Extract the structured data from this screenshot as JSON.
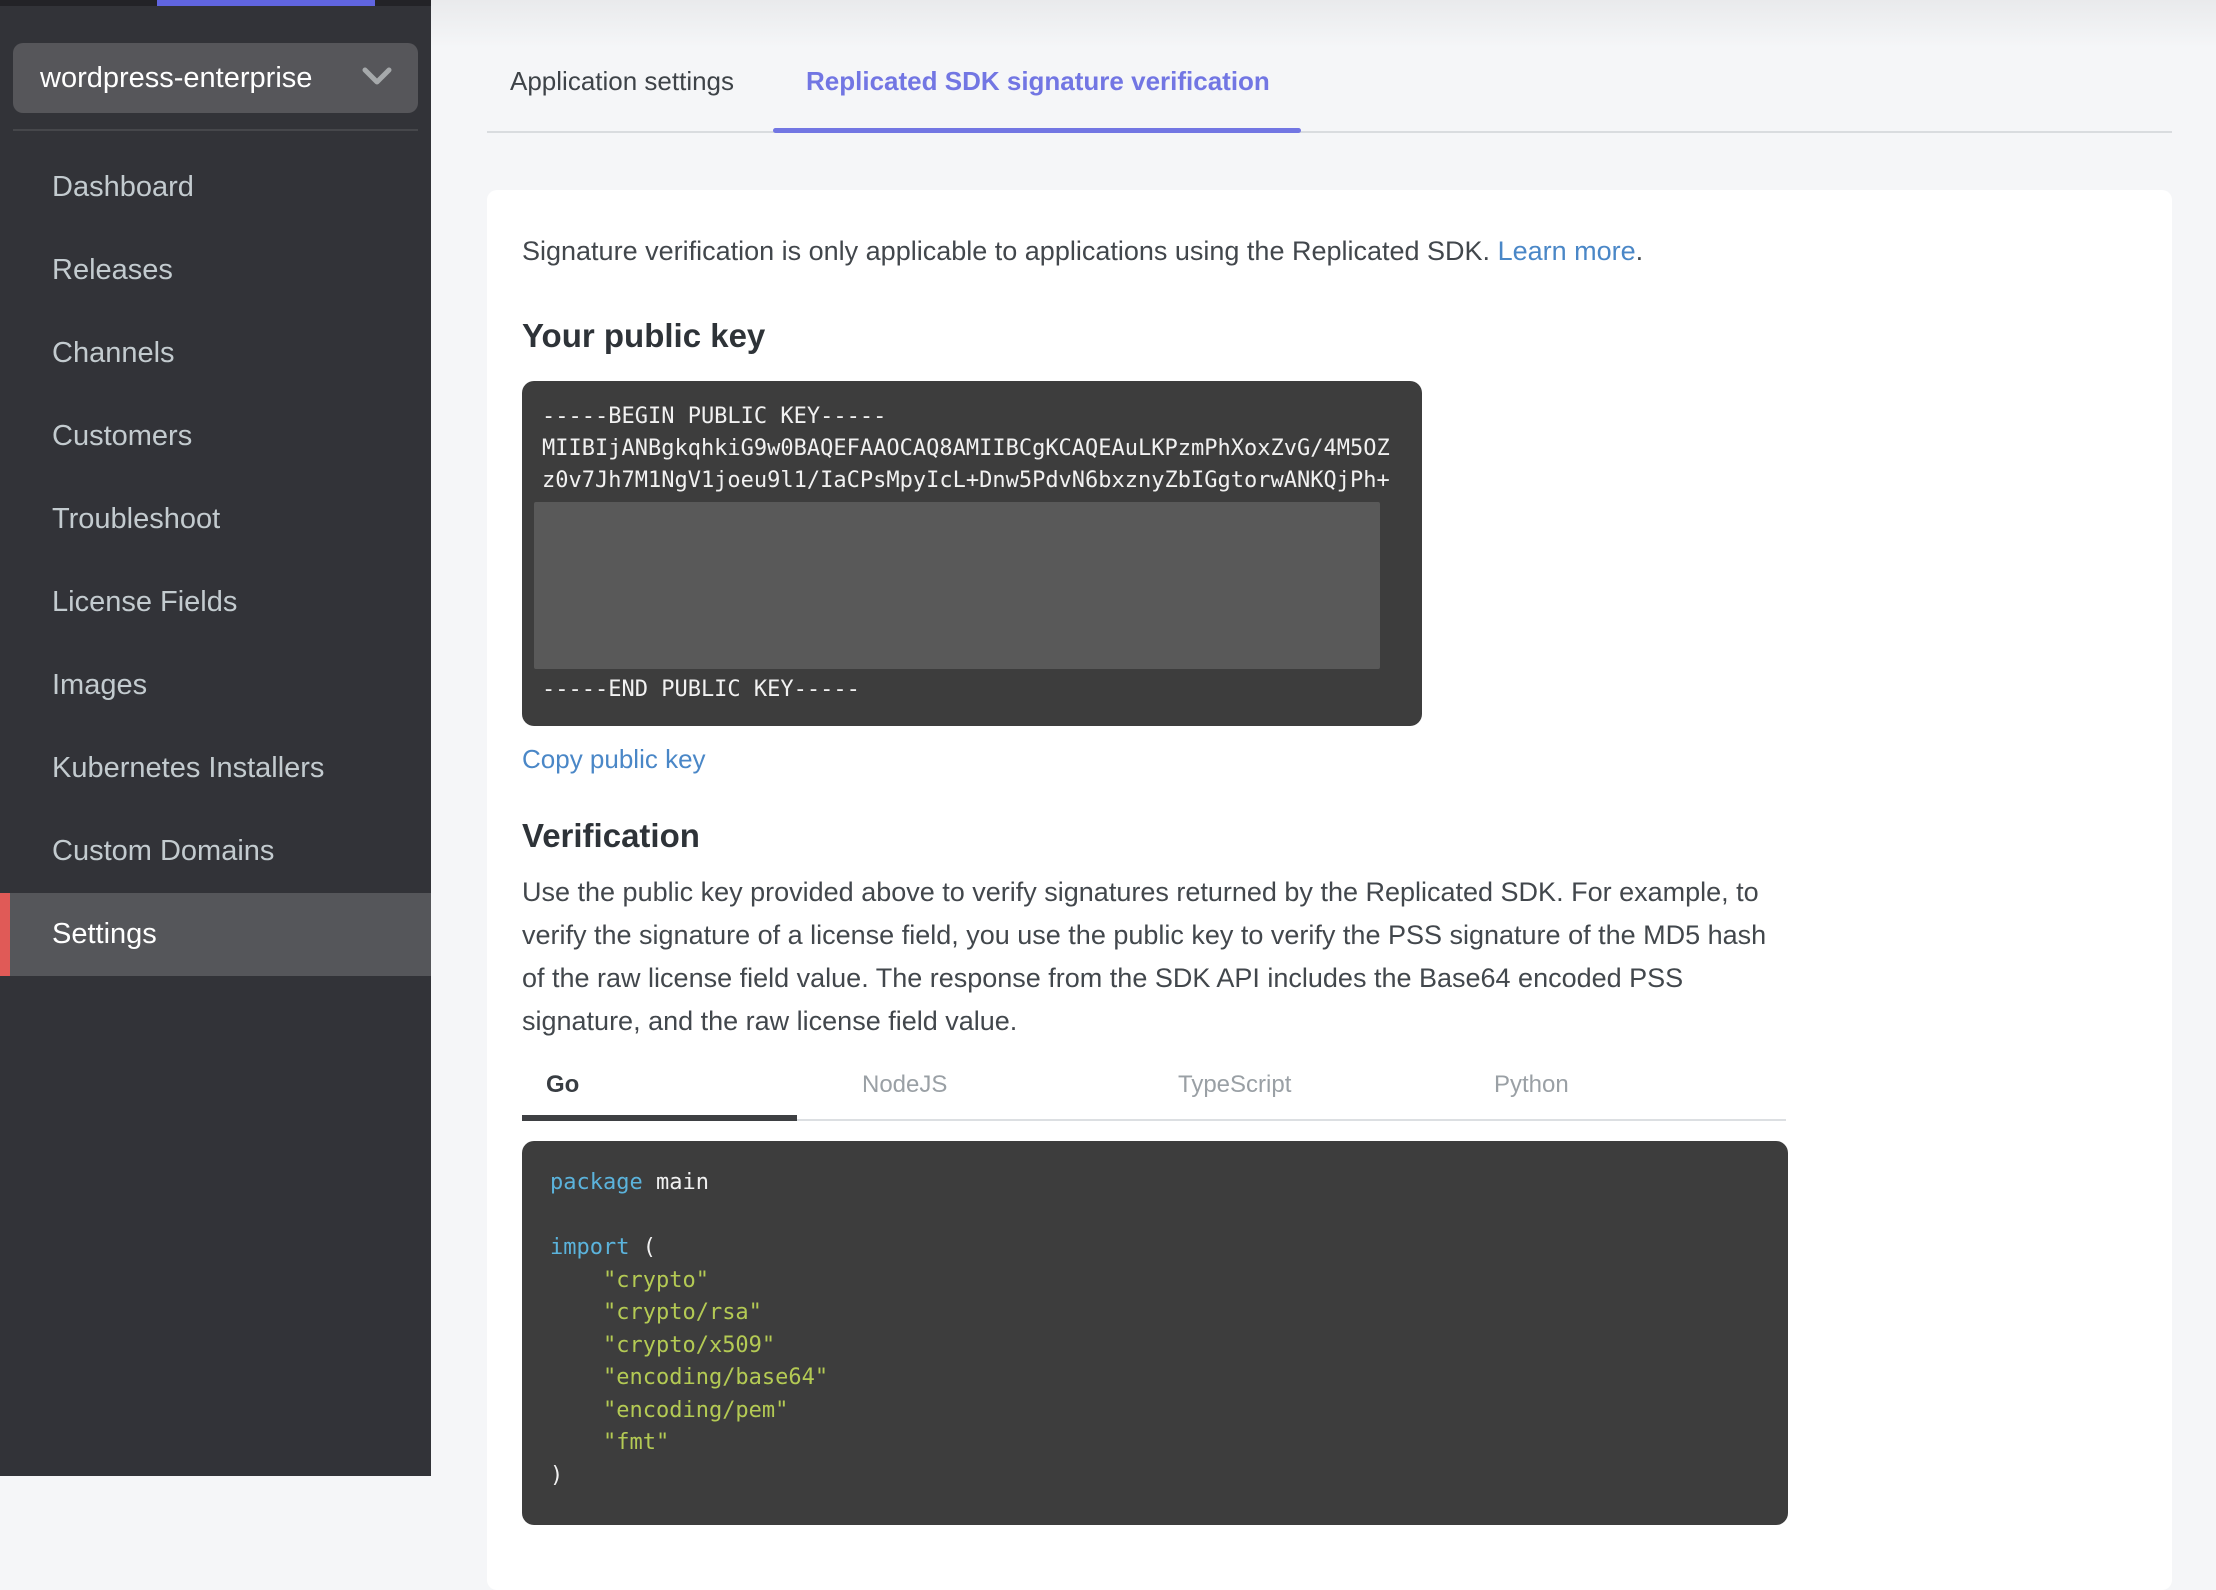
{
  "top_bar": {
    "accent_color": "#6065e0"
  },
  "sidebar": {
    "app_selector": {
      "value": "wordpress-enterprise"
    },
    "items": [
      {
        "label": "Dashboard",
        "selected": false
      },
      {
        "label": "Releases",
        "selected": false
      },
      {
        "label": "Channels",
        "selected": false
      },
      {
        "label": "Customers",
        "selected": false
      },
      {
        "label": "Troubleshoot",
        "selected": false
      },
      {
        "label": "License Fields",
        "selected": false
      },
      {
        "label": "Images",
        "selected": false
      },
      {
        "label": "Kubernetes Installers",
        "selected": false
      },
      {
        "label": "Custom Domains",
        "selected": false
      },
      {
        "label": "Settings",
        "selected": true
      }
    ],
    "selected_accent_color": "#e05a57"
  },
  "tabs": [
    {
      "label": "Application settings",
      "active": false
    },
    {
      "label": "Replicated SDK signature verification",
      "active": true
    }
  ],
  "content": {
    "intro": {
      "text": "Signature verification is only applicable to applications using the Replicated SDK. ",
      "link": "Learn more",
      "after_link": "."
    },
    "public_key": {
      "heading": "Your public key",
      "lines_visible_top": [
        "-----BEGIN PUBLIC KEY-----",
        "MIIBIjANBgkqhkiG9w0BAQEFAAOCAQ8AMIIBCgKCAQEAuLKPzmPhXoxZvG/4M5OZ",
        "z0v7Jh7M1NgV1joeu9l1/IaCPsMpyIcL+Dnw5PdvN6bxznyZbIGgtorwANKQjPh+"
      ],
      "redacted_region": true,
      "line_end": "-----END PUBLIC KEY-----",
      "copy_link": "Copy public key"
    },
    "verification": {
      "heading": "Verification",
      "body": "Use the public key provided above to verify signatures returned by the Replicated SDK. For example, to verify the signature of a license field, you use the public key to verify the PSS signature of the MD5 hash of the raw license field value. The response from the SDK API includes the Base64 encoded PSS signature, and the raw license field value.",
      "lang_tabs": [
        {
          "label": "Go",
          "active": true
        },
        {
          "label": "NodeJS",
          "active": false
        },
        {
          "label": "TypeScript",
          "active": false
        },
        {
          "label": "Python",
          "active": false
        }
      ],
      "code": {
        "language": "go",
        "lines": [
          [
            {
              "t": "kw",
              "v": "package"
            },
            {
              "t": "plain",
              "v": " main"
            }
          ],
          [],
          [
            {
              "t": "kw",
              "v": "import"
            },
            {
              "t": "plain",
              "v": " ("
            }
          ],
          [
            {
              "t": "plain",
              "v": "    "
            },
            {
              "t": "str",
              "v": "\"crypto\""
            }
          ],
          [
            {
              "t": "plain",
              "v": "    "
            },
            {
              "t": "str",
              "v": "\"crypto/rsa\""
            }
          ],
          [
            {
              "t": "plain",
              "v": "    "
            },
            {
              "t": "str",
              "v": "\"crypto/x509\""
            }
          ],
          [
            {
              "t": "plain",
              "v": "    "
            },
            {
              "t": "str",
              "v": "\"encoding/base64\""
            }
          ],
          [
            {
              "t": "plain",
              "v": "    "
            },
            {
              "t": "str",
              "v": "\"encoding/pem\""
            }
          ],
          [
            {
              "t": "plain",
              "v": "    "
            },
            {
              "t": "str",
              "v": "\"fmt\""
            }
          ],
          [
            {
              "t": "plain",
              "v": ")"
            }
          ]
        ]
      }
    }
  },
  "colors": {
    "sidebar_bg": "#323338",
    "sidebar_selected_bg": "#55565a",
    "nav_text": "#c3cbcf",
    "active_tab": "#7276e3",
    "link_blue": "#4a87c7",
    "code_bg": "#3d3d3d",
    "code_keyword": "#5bb3dc",
    "code_string": "#b4ca54",
    "redacted_bg": "#595959",
    "page_bg": "#f5f6f8"
  }
}
